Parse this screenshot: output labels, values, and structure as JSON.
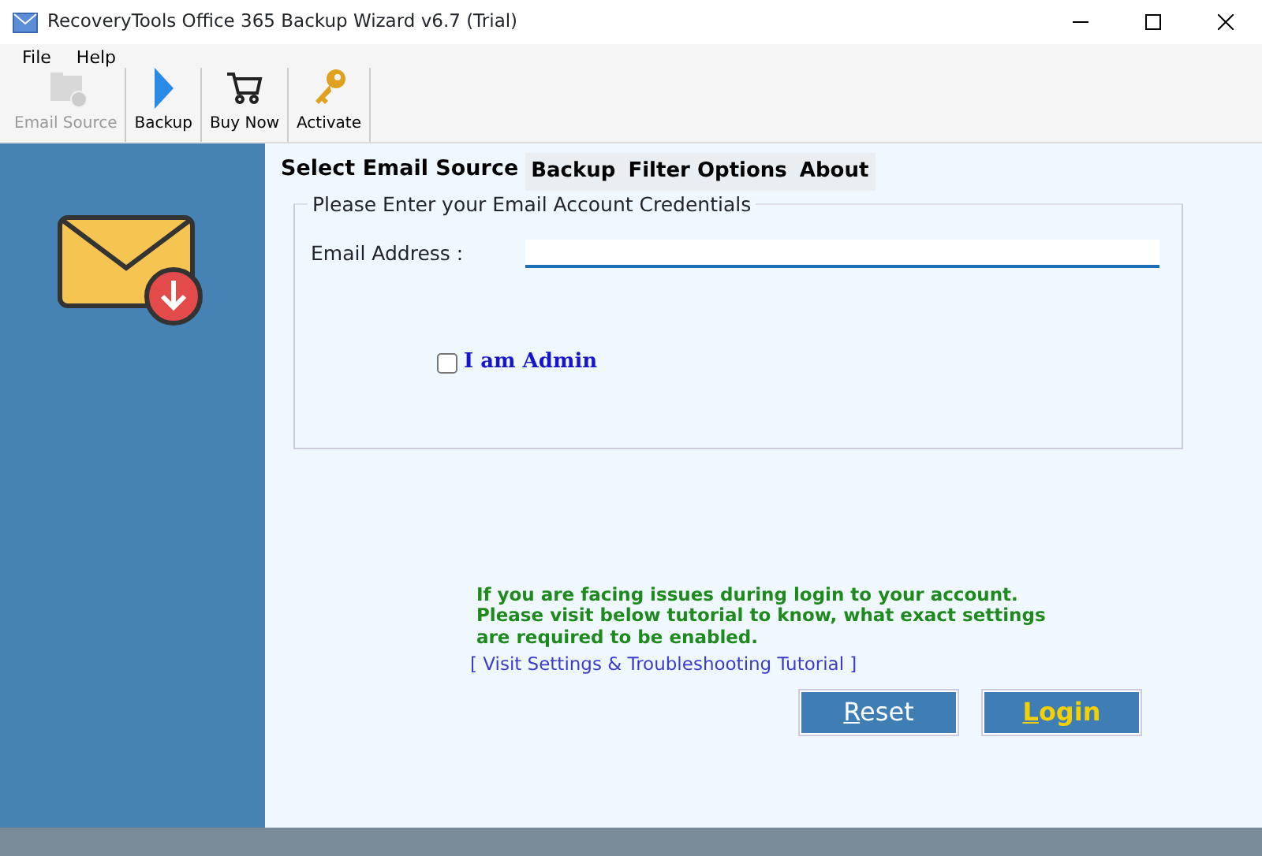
{
  "window": {
    "title": "RecoveryTools Office 365 Backup Wizard v6.7 (Trial)"
  },
  "menu": [
    "File",
    "Help"
  ],
  "toolbar": [
    {
      "kind": "folder",
      "label": "Email Source",
      "disabled": true
    },
    {
      "kind": "play",
      "label": "Backup",
      "disabled": false
    },
    {
      "kind": "cart",
      "label": "Buy Now",
      "disabled": false
    },
    {
      "kind": "key",
      "label": "Activate",
      "disabled": false
    }
  ],
  "tabs": [
    {
      "label": "Select Email Source",
      "selected": true
    },
    {
      "label": "Backup",
      "selected": false
    },
    {
      "label": "Filter Options",
      "selected": false
    },
    {
      "label": "About",
      "selected": false
    }
  ],
  "credentials": {
    "legend": "Please Enter your Email Account Credentials",
    "email_label": "Email Address :",
    "admin": {
      "label": "I am Admin",
      "checked": false
    }
  },
  "help_text": "If you are facing issues during login to your account.\nPlease visit below tutorial to know, what exact settings\nare required to be enabled.",
  "tutorial_link": "[ Visit Settings & Troubleshooting Tutorial ]",
  "buttons": [
    {
      "label": "Reset",
      "kind": "reset"
    },
    {
      "label": "Login",
      "kind": "login"
    }
  ]
}
